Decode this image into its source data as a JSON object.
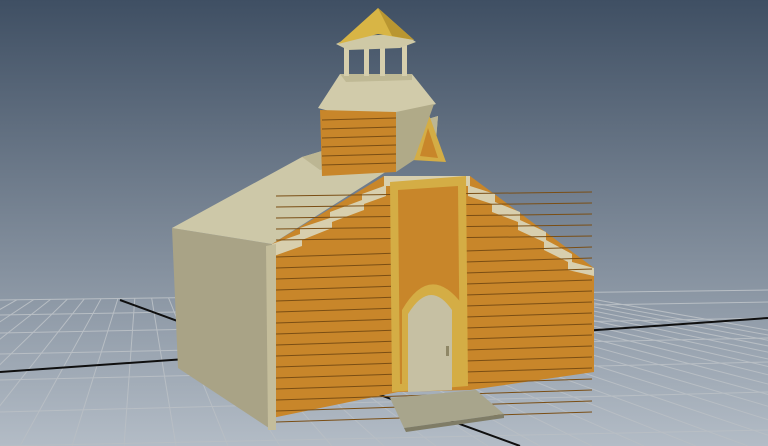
{
  "viewport": {
    "name": "3d-viewport",
    "background_top": "#3f4f63",
    "background_bottom": "#b3bcc6",
    "grid_color": "#b8bec4",
    "grid_axis_color": "#0f0f0f"
  },
  "model": {
    "name": "church-building-model",
    "colors": {
      "wood_plank": "#c8862a",
      "wood_plank_dark": "#a86c1c",
      "plank_line": "#7a4e14",
      "trim_yellow": "#d4ad45",
      "trim_yellow_dark": "#a98a2e",
      "roof_light": "#d2cdae",
      "roof_mid": "#bdb795",
      "roof_shadow": "#96916f",
      "door_panel": "#c6c0a3",
      "step": "#a8a58c",
      "belfry_roof": "#d8b545"
    }
  },
  "axis_label": ""
}
